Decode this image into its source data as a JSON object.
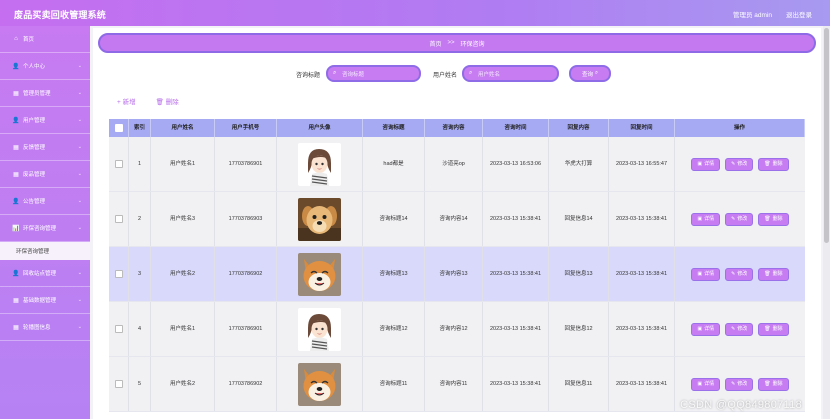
{
  "app": {
    "title": "废品买卖回收管理系统"
  },
  "top": {
    "user": "管理员 admin",
    "logout": "退出登录"
  },
  "sidebar": {
    "items": [
      {
        "label": "首页",
        "icon": "home-icon",
        "glyph": "⌂",
        "chev": false
      },
      {
        "label": "个人中心",
        "icon": "user-icon",
        "glyph": "👤",
        "chev": true
      },
      {
        "label": "管理员管理",
        "icon": "admin-icon",
        "glyph": "▦",
        "chev": true
      },
      {
        "label": "用户管理",
        "icon": "users-icon",
        "glyph": "👤",
        "chev": true
      },
      {
        "label": "反馈管理",
        "icon": "feedback-icon",
        "glyph": "▦",
        "chev": true
      },
      {
        "label": "废品管理",
        "icon": "grid-icon",
        "glyph": "▦",
        "chev": true
      },
      {
        "label": "公告管理",
        "icon": "notice-icon",
        "glyph": "👤",
        "chev": true
      },
      {
        "label": "环保咨询管理",
        "icon": "chart-icon",
        "glyph": "📊",
        "chev": true
      }
    ],
    "sub_item": "环保咨询管理",
    "items_after": [
      {
        "label": "回收站点管理",
        "icon": "station-icon",
        "glyph": "👤",
        "chev": true
      },
      {
        "label": "基础数据管理",
        "icon": "data-icon",
        "glyph": "▦",
        "chev": true
      },
      {
        "label": "轮播图信息",
        "icon": "carousel-icon",
        "glyph": "▦",
        "chev": true
      }
    ]
  },
  "breadcrumb": {
    "home": "首页",
    "sep": ">>",
    "current": "环保咨询"
  },
  "search": {
    "title_label": "咨询标题",
    "title_placeholder": "咨询标题",
    "name_label": "用户姓名",
    "name_placeholder": "用户姓名",
    "button": "查询"
  },
  "actions": {
    "add": "+ 新增",
    "delete": "删除"
  },
  "table": {
    "headers": [
      "索引",
      "用户姓名",
      "用户手机号",
      "用户头像",
      "咨询标题",
      "咨询内容",
      "咨询时间",
      "回复内容",
      "回复时间",
      "操作"
    ],
    "rows": [
      {
        "idx": "1",
        "name": "用户姓名1",
        "phone": "17703786901",
        "avatar": "girl",
        "title": "had都是",
        "content": "沙道亮op",
        "time": "2023-03-13 16:53:06",
        "reply": "华虎大打算",
        "reply_time": "2023-03-13 16:55:47"
      },
      {
        "idx": "2",
        "name": "用户姓名3",
        "phone": "17703786903",
        "avatar": "puppy",
        "title": "咨询标题14",
        "content": "咨询内容14",
        "time": "2023-03-13 15:38:41",
        "reply": "回复信息14",
        "reply_time": "2023-03-13 15:38:41"
      },
      {
        "idx": "3",
        "name": "用户姓名2",
        "phone": "17703786902",
        "avatar": "shiba",
        "title": "咨询标题13",
        "content": "咨询内容13",
        "time": "2023-03-13 15:38:41",
        "reply": "回复信息13",
        "reply_time": "2023-03-13 15:38:41"
      },
      {
        "idx": "4",
        "name": "用户姓名1",
        "phone": "17703786901",
        "avatar": "girl",
        "title": "咨询标题12",
        "content": "咨询内容12",
        "time": "2023-03-13 15:38:41",
        "reply": "回复信息12",
        "reply_time": "2023-03-13 15:38:41"
      },
      {
        "idx": "5",
        "name": "用户姓名2",
        "phone": "17703786902",
        "avatar": "shiba",
        "title": "咨询标题11",
        "content": "咨询内容11",
        "time": "2023-03-13 15:38:41",
        "reply": "回复信息11",
        "reply_time": "2023-03-13 15:38:41"
      }
    ],
    "ops": {
      "detail": "详情",
      "edit": "修改",
      "delete": "删除"
    }
  },
  "watermark": "CSDN @QQ849807118",
  "colors": {
    "accent": "#c77cf1",
    "border": "#8f6ce7",
    "header": "#a6aaf3",
    "highlight": "#d9dafb"
  }
}
